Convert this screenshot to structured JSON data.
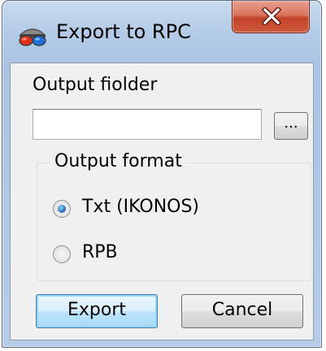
{
  "window": {
    "title": "Export to RPC",
    "app_icon": "red-blue-3d-glasses-icon",
    "close_icon": "close-x-icon",
    "colors": {
      "titlebar": "#b3cbe6",
      "close_button": "#c24127",
      "client": "#f0f0f0"
    }
  },
  "form": {
    "folder_label": "Output fiolder",
    "folder_value": "",
    "browse_label": "...",
    "format_group_title": "Output format",
    "formats": [
      {
        "label": "Txt (IKONOS)",
        "selected": true
      },
      {
        "label": "RPB",
        "selected": false
      }
    ]
  },
  "buttons": {
    "export_label": "Export",
    "cancel_label": "Cancel"
  }
}
